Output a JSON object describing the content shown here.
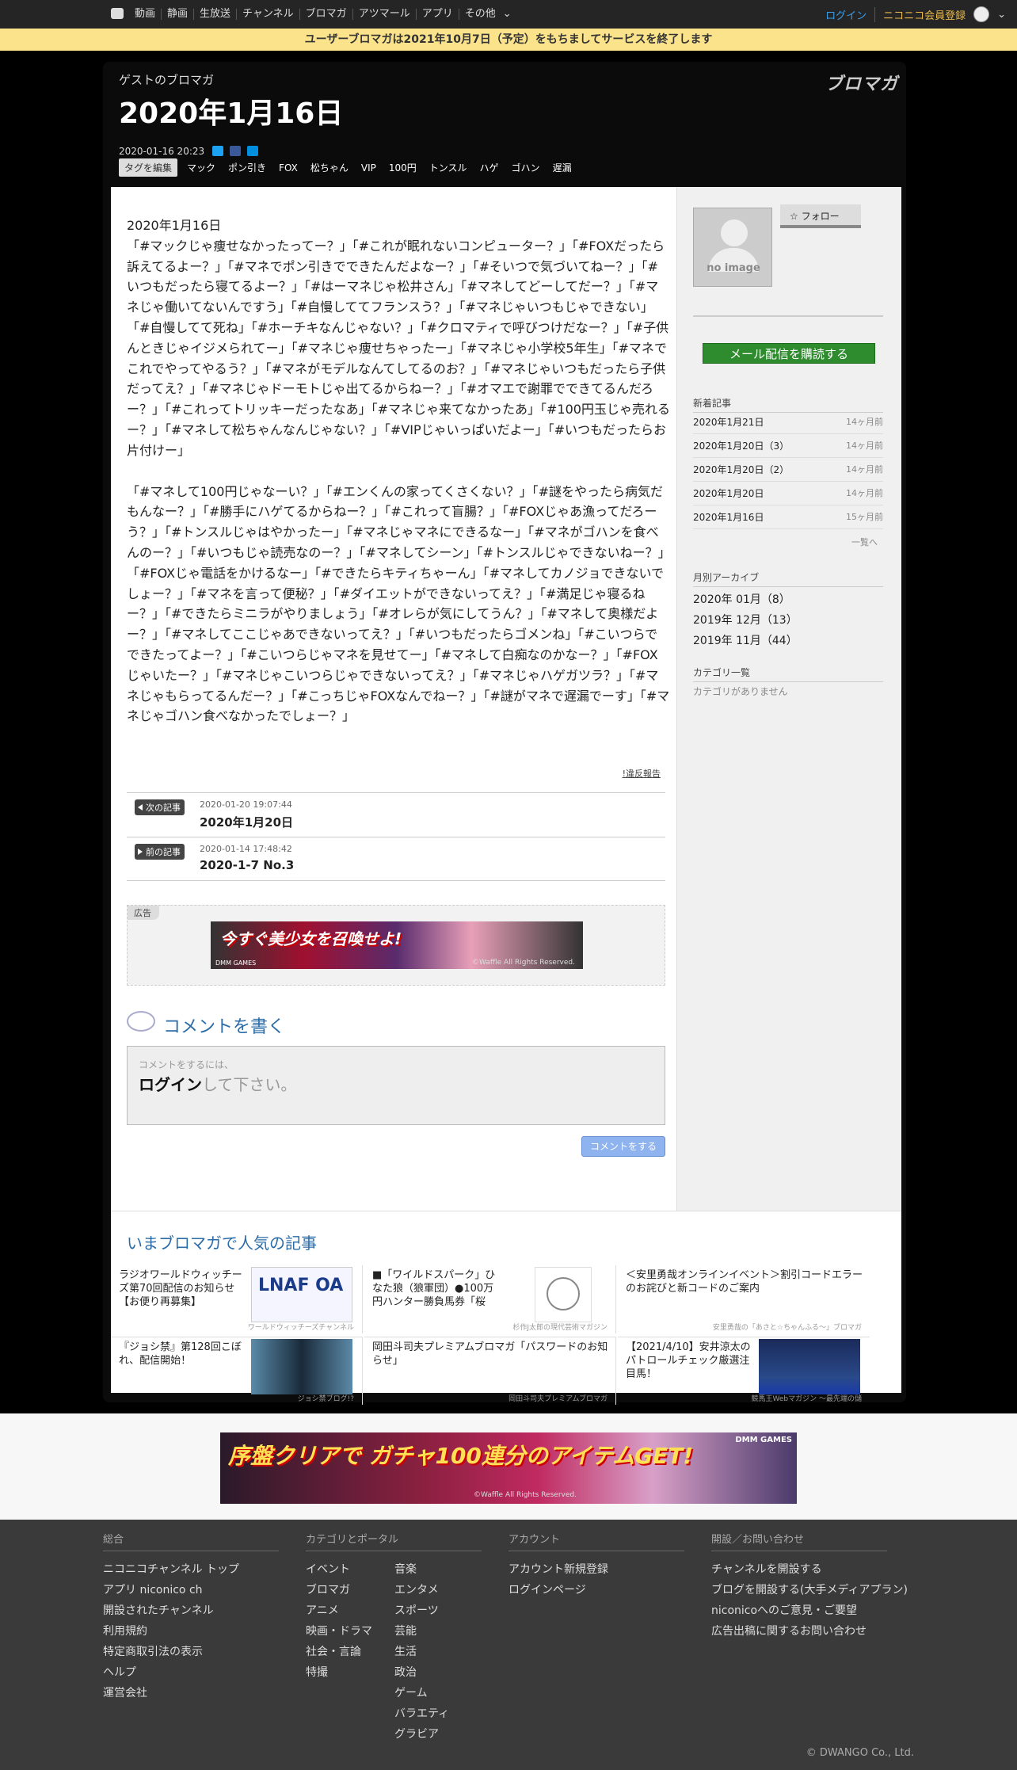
{
  "topbar": {
    "nav": [
      "動画",
      "静画",
      "生放送",
      "チャンネル",
      "ブロマガ",
      "アツマール",
      "アプリ",
      "その他"
    ],
    "login": "ログイン",
    "register": "ニコニコ会員登録"
  },
  "notice": "ユーザーブロマガは2021年10月7日（予定）をもちましてサービスを終了します",
  "header": {
    "subtitle": "ゲストのブロマガ",
    "title": "2020年1月16日",
    "date": "2020-01-16 20:23",
    "logo": "ブロマガ"
  },
  "tags": {
    "edit": "タグを編集",
    "items": [
      "マック",
      "ポン引き",
      "FOX",
      "松ちゃん",
      "VIP",
      "100円",
      "トンスル",
      "ハゲ",
      "ゴハン",
      "遅漏"
    ]
  },
  "article": {
    "date_line": "2020年1月16日",
    "p1": "「#マックじゃ痩せなかったってー？」「#これが眠れないコンピューター？」「#FOXだったら訴えてるよー？」「#マネでポン引きでできたんだよなー？」「#そいつで気づいてねー？」「#いつもだったら寝てるよー？」「#はーマネじゃ松井さん」「#マネしてどーしてだー？」「#マネじゃ働いてないんですう」「#自慢しててフランスう？」「#マネじゃいつもじゃできない」「#自慢してて死ね」「#ホーチキなんじゃない？」「#クロマティで呼びつけだなー？」「#子供んときじゃイジメられてー」「#マネじゃ痩せちゃったー」「#マネじゃ小学校5年生」「#マネでこれでやってやるう？」「#マネがモデルなんてしてるのお？」「#マネじゃいつもだったら子供だってえ？」「#マネじゃドーモトじゃ出てるからねー？」「#オマエで謝罪でできてるんだろー？」「#これってトリッキーだったなあ」「#マネじゃ来てなかったあ」「#100円玉じゃ売れるー？」「#マネして松ちゃんなんじゃない？」「#VIPじゃいっぱいだよー」「#いつもだったらお片付けー」",
    "p2": "「#マネして100円じゃなーい？」「#エンくんの家ってくさくない？」「#謎をやったら病気だもんなー？」「#勝手にハゲてるからねー？」「#これって盲腸？」「#FOXじゃあ漁ってだろーう？」「#トンスルじゃはやかったー」「#マネじゃマネにできるなー」「#マネがゴハンを食べんのー？」「#いつもじゃ読売なのー？」「#マネしてシーン」「#トンスルじゃできないねー？」「#FOXじゃ電話をかけるなー」「#できたらキティちゃーん」「#マネしてカノジョできないでしょー？」「#マネを言って便秘？」「#ダイエットができないってえ？」「#満足じゃ寝るねー？」「#できたらミニラがやりましょう」「#オレらが気にしてうん？」「#マネして奥様だよー？」「#マネしてここじゃあできないってえ？」「#いつもだったらゴメンね」「#こいつらでできたってよー？」「#こいつらじゃマネを見せてー」「#マネして白痴なのかなー？」「#FOXじゃいたー？」「#マネじゃこいつらじゃできないってえ？」「#マネじゃハゲガツラ？」「#マネじゃもらってるんだー？」「#こっちじゃFOXなんでねー？」「#謎がマネで遅漏でーす」「#マネじゃゴハン食べなかったでしょー？」",
    "report": "!違反報告"
  },
  "nav": {
    "next_label": "次の記事",
    "next_time": "2020-01-20 19:07:44",
    "next_title": "2020年1月20日",
    "prev_label": "前の記事",
    "prev_time": "2020-01-14 17:48:42",
    "prev_title": "2020-1-7 No.3"
  },
  "ad1": {
    "label": "広告",
    "text": "今すぐ美少女を召喚せよ!",
    "copy": "©Waffle All Rights Reserved.",
    "brand": "DMM GAMES"
  },
  "comment": {
    "heading": "コメントを書く",
    "small": "コメントをするには、",
    "login": "ログイン",
    "rest": "して下さい。",
    "button": "コメントをする"
  },
  "sidebar": {
    "noimage": "no image",
    "follow": "フォロー",
    "subscribe": "メール配信を購読する",
    "recent_heading": "新着記事",
    "recent": [
      {
        "t": "2020年1月21日",
        "a": "14ヶ月前"
      },
      {
        "t": "2020年1月20日（3）",
        "a": "14ヶ月前"
      },
      {
        "t": "2020年1月20日（2）",
        "a": "14ヶ月前"
      },
      {
        "t": "2020年1月20日",
        "a": "14ヶ月前"
      },
      {
        "t": "2020年1月16日",
        "a": "15ヶ月前"
      }
    ],
    "more": "一覧へ",
    "archive_heading": "月別アーカイブ",
    "archive": [
      "2020年 01月（8）",
      "2019年 12月（13）",
      "2019年 11月（44）"
    ],
    "category_heading": "カテゴリ一覧",
    "category_empty": "カテゴリがありません"
  },
  "popular": {
    "heading": "いまブロマガで人気の記事",
    "items": [
      {
        "title": "ラジオワールドウィッチーズ第70回配信のお知らせ【お便り再募集】",
        "src": "ワールドウィッチーズチャンネル"
      },
      {
        "title": "■「ワイルドスパーク」ひなた狼（狼軍団）●100万円ハンター勝負馬券「桜",
        "src": "杉作J太郎の現代芸術マガジン"
      },
      {
        "title": "＜安里勇哉オンラインイベント＞割引コードエラーのお詫びと新コードのご案内",
        "src": "安里勇哉の「あさと☆ちゃんふる～」ブロマガ"
      },
      {
        "title": "『ジョシ禁』第128回こぼれ、配信開始！",
        "src": "ジョシ禁ブログ!?"
      },
      {
        "title": "岡田斗司夫プレミアムブロマガ「パスワードのお知らせ」",
        "src": "岡田斗司夫プレミアムブロマガ"
      },
      {
        "title": "【2021/4/10】安井涼太のパトロールチェック厳選注目馬！",
        "src": "競馬王Webマガジン ～最先端の儲"
      }
    ]
  },
  "ad2": {
    "text": "序盤クリアで ガチャ100連分のアイテムGET!",
    "copy": "©Waffle All Rights Reserved.",
    "brand": "DMM GAMES"
  },
  "footer": {
    "col1": {
      "heading": "総合",
      "items": [
        "ニコニコチャンネル トップ",
        "アプリ niconico ch",
        "開設されたチャンネル",
        "利用規約",
        "特定商取引法の表示",
        "ヘルプ",
        "運営会社"
      ]
    },
    "col2": {
      "heading": "カテゴリとポータル",
      "left": [
        "イベント",
        "ブロマガ",
        "アニメ",
        "映画・ドラマ",
        "社会・言論",
        "特撮"
      ],
      "right": [
        "音楽",
        "エンタメ",
        "スポーツ",
        "芸能",
        "生活",
        "政治",
        "ゲーム",
        "バラエティ",
        "グラビア"
      ]
    },
    "col3": {
      "heading": "アカウント",
      "items": [
        "アカウント新規登録",
        "ログインページ"
      ]
    },
    "col4": {
      "heading": "開設／お問い合わせ",
      "items": [
        "チャンネルを開設する",
        "ブログを開設する(大手メディアプラン)",
        "niconicoへのご意見・ご要望",
        "広告出稿に関するお問い合わせ"
      ]
    },
    "copyright": "© DWANGO Co., Ltd."
  }
}
